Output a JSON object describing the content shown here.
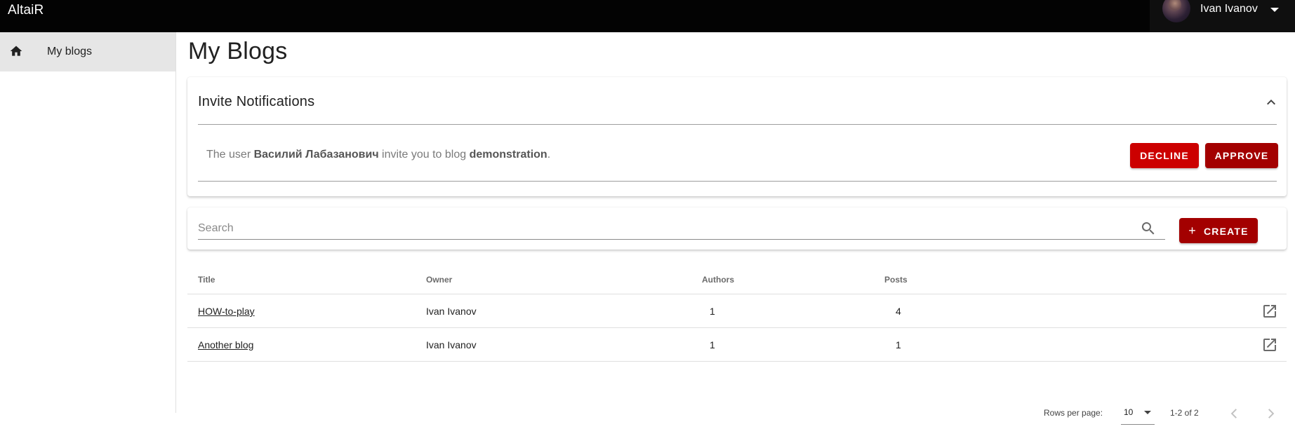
{
  "app": {
    "title": "AltaiR",
    "user_name": "Ivan Ivanov"
  },
  "sidebar": {
    "items": [
      {
        "label": "My blogs",
        "icon": "home-icon",
        "active": true
      }
    ]
  },
  "main": {
    "title": "My Blogs"
  },
  "invites": {
    "title": "Invite Notifications",
    "message": {
      "prefix": "The user ",
      "user": "Василий Лабазанович",
      "middle": " invite you to blog ",
      "blog": "demonstration",
      "suffix": "."
    },
    "decline_label": "DECLINE",
    "approve_label": "APPROVE"
  },
  "search": {
    "placeholder": "Search",
    "value": "",
    "create_label": "CREATE"
  },
  "table": {
    "headers": [
      "Title",
      "Owner",
      "Authors",
      "Posts"
    ],
    "rows": [
      {
        "title": "HOW-to-play",
        "owner": "Ivan Ivanov",
        "authors": "1",
        "posts": "4"
      },
      {
        "title": "Another blog",
        "owner": "Ivan Ivanov",
        "authors": "1",
        "posts": "1"
      }
    ]
  },
  "pagination": {
    "rows_per_page_label": "Rows per page:",
    "rows_per_page": "10",
    "page_info": "1-2 of 2"
  },
  "colors": {
    "topbar": "#030303",
    "decline": "#cc0000",
    "approve": "#a30000",
    "create": "#a30000",
    "sidebar_active": "#e6e6e6"
  }
}
